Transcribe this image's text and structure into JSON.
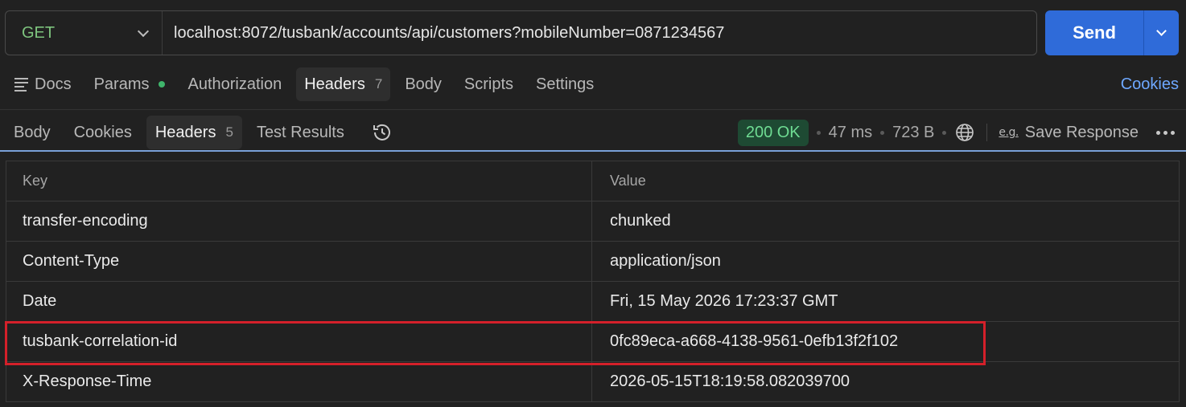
{
  "request": {
    "method": "GET",
    "url": "localhost:8072/tusbank/accounts/api/customers?mobileNumber=0871234567",
    "send_label": "Send"
  },
  "request_tabs": {
    "docs": "Docs",
    "params": "Params",
    "authorization": "Authorization",
    "headers": "Headers",
    "headers_count": "7",
    "body": "Body",
    "scripts": "Scripts",
    "settings": "Settings",
    "cookies_link": "Cookies"
  },
  "response_tabs": {
    "body": "Body",
    "cookies": "Cookies",
    "headers": "Headers",
    "headers_count": "5",
    "test_results": "Test Results"
  },
  "response_meta": {
    "status": "200 OK",
    "time": "47 ms",
    "size": "723 B",
    "save_icon_text": "e.g.",
    "save_response": "Save Response"
  },
  "table": {
    "key_header": "Key",
    "value_header": "Value",
    "rows": [
      {
        "key": "transfer-encoding",
        "value": "chunked"
      },
      {
        "key": "Content-Type",
        "value": "application/json"
      },
      {
        "key": "Date",
        "value": "Fri, 15 May 2026 17:23:37 GMT"
      },
      {
        "key": "tusbank-correlation-id",
        "value": "0fc89eca-a668-4138-9561-0efb13f2f102"
      },
      {
        "key": "X-Response-Time",
        "value": "2026-05-15T18:19:58.082039700"
      }
    ]
  },
  "colors": {
    "accent": "#2f6bd9",
    "status_ok_bg": "#1e4a33",
    "status_ok_text": "#6fdc93",
    "method_get": "#7ec47e",
    "highlight": "#d4202a"
  }
}
